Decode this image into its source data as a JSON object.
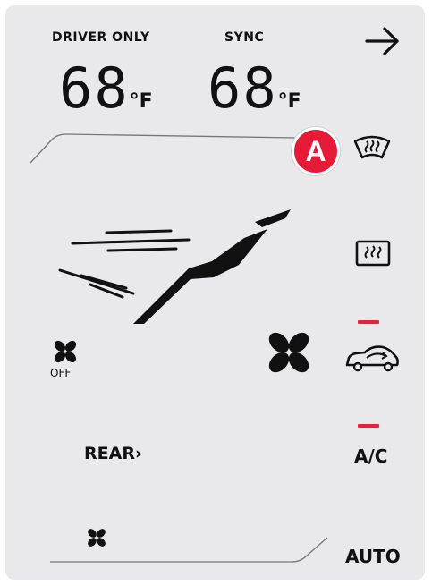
{
  "header": {
    "driver_only_label": "DRIVER ONLY",
    "sync_label": "SYNC",
    "driver_temp": "68",
    "sync_temp": "68",
    "unit": "°F",
    "next_icon": "arrow-right-icon"
  },
  "callout": {
    "label": "A",
    "color": "#e41a36"
  },
  "right_column": {
    "front_defrost_icon": "front-defrost-icon",
    "rear_defrost_icon": "rear-defrost-icon",
    "recirculation_icon": "recirculation-icon",
    "ac_label": "A/C",
    "auto_label": "AUTO"
  },
  "fan": {
    "off_label": "OFF",
    "rear_label": "REAR",
    "rear_chevron": "›"
  },
  "colors": {
    "background": "#e9e9eb",
    "indicator": "#e8213a",
    "text": "#111111"
  }
}
